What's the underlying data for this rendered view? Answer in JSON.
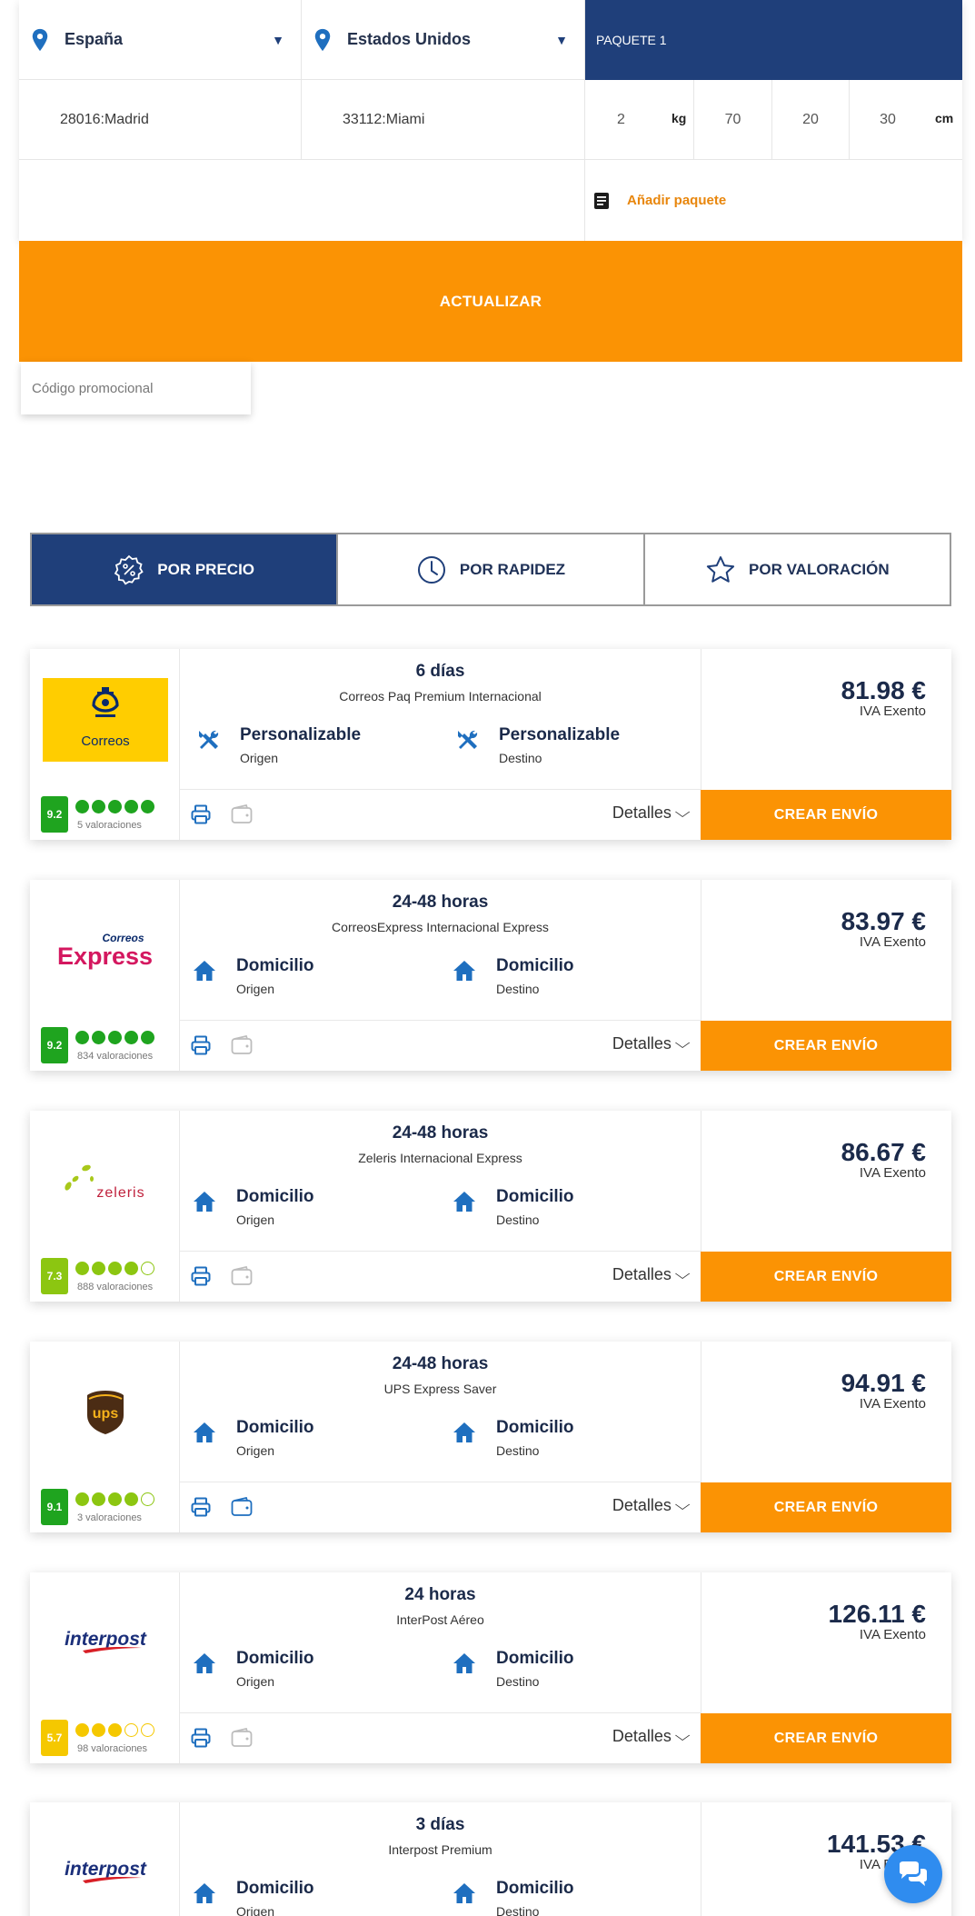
{
  "form": {
    "origin_country": "España",
    "destination_country": "Estados Unidos",
    "package_label": "PAQUETE 1",
    "origin_postal": "28016:Madrid",
    "destination_postal": "33112:Miami",
    "weight": "2",
    "weight_unit": "kg",
    "length": "70",
    "width": "20",
    "height": "30",
    "size_unit": "cm",
    "add_package": "Añadir paquete",
    "update_button": "ACTUALIZAR",
    "promo_placeholder": "Código promocional"
  },
  "sort_tabs": [
    {
      "label": "POR PRECIO",
      "active": true,
      "icon": "discount-badge-icon"
    },
    {
      "label": "POR RAPIDEZ",
      "active": false,
      "icon": "clock-icon"
    },
    {
      "label": "POR VALORACIÓN",
      "active": false,
      "icon": "star-icon"
    }
  ],
  "colors": {
    "navy": "#1f3f7a",
    "orange": "#fb9304",
    "score_green": "#1fa41f",
    "score_lime": "#8cc611",
    "score_yellow": "#f5c800",
    "icon_blue": "#1f6fbf"
  },
  "offers": [
    {
      "carrier": "Correos",
      "time": "6 días",
      "service": "Correos Paq Premium Internacional",
      "origin_mode": "Personalizable",
      "origin_label": "Origen",
      "dest_mode": "Personalizable",
      "dest_label": "Destino",
      "mode_icon": "tools-icon",
      "score": "9.2",
      "dots_filled": 5,
      "reviews": "5 valoraciones",
      "price": "81.98 €",
      "tax": "IVA Exento",
      "details": "Detalles",
      "cta": "CREAR ENVÍO"
    },
    {
      "carrier": "Correos Express",
      "logo_line1": "Correos",
      "logo_line2": "Express",
      "time": "24-48 horas",
      "service": "CorreosExpress Internacional Express",
      "origin_mode": "Domicilio",
      "origin_label": "Origen",
      "dest_mode": "Domicilio",
      "dest_label": "Destino",
      "mode_icon": "home-icon",
      "score": "9.2",
      "dots_filled": 5,
      "reviews": "834 valoraciones",
      "price": "83.97 €",
      "tax": "IVA Exento",
      "details": "Detalles",
      "cta": "CREAR ENVÍO"
    },
    {
      "carrier": "Zeleris",
      "logo_text": "zeleris",
      "time": "24-48 horas",
      "service": "Zeleris Internacional Express",
      "origin_mode": "Domicilio",
      "origin_label": "Origen",
      "dest_mode": "Domicilio",
      "dest_label": "Destino",
      "mode_icon": "home-icon",
      "score": "7.3",
      "dots_filled": 4,
      "reviews": "888 valoraciones",
      "price": "86.67 €",
      "tax": "IVA Exento",
      "details": "Detalles",
      "cta": "CREAR ENVÍO"
    },
    {
      "carrier": "UPS",
      "logo_text": "ups",
      "time": "24-48 horas",
      "service": "UPS Express Saver",
      "origin_mode": "Domicilio",
      "origin_label": "Origen",
      "dest_mode": "Domicilio",
      "dest_label": "Destino",
      "mode_icon": "home-icon",
      "score": "9.1",
      "dots_filled": 4,
      "reviews": "3 valoraciones",
      "price": "94.91 €",
      "tax": "IVA Exento",
      "details": "Detalles",
      "cta": "CREAR ENVÍO"
    },
    {
      "carrier": "InterPost",
      "logo_text": "interpost",
      "time": "24 horas",
      "service": "InterPost Aéreo",
      "origin_mode": "Domicilio",
      "origin_label": "Origen",
      "dest_mode": "Domicilio",
      "dest_label": "Destino",
      "mode_icon": "home-icon",
      "score": "5.7",
      "dots_filled": 3,
      "reviews": "98 valoraciones",
      "price": "126.11 €",
      "tax": "IVA Exento",
      "details": "Detalles",
      "cta": "CREAR ENVÍO"
    },
    {
      "carrier": "InterPost",
      "logo_text": "interpost",
      "time": "3 días",
      "service": "Interpost Premium",
      "origin_mode": "Domicilio",
      "origin_label": "Origen",
      "dest_mode": "Domicilio",
      "dest_label": "Destino",
      "mode_icon": "home-icon",
      "price": "141.53 €",
      "tax": "IVA Exento"
    }
  ],
  "chat_icon": "chat-bubbles-icon"
}
